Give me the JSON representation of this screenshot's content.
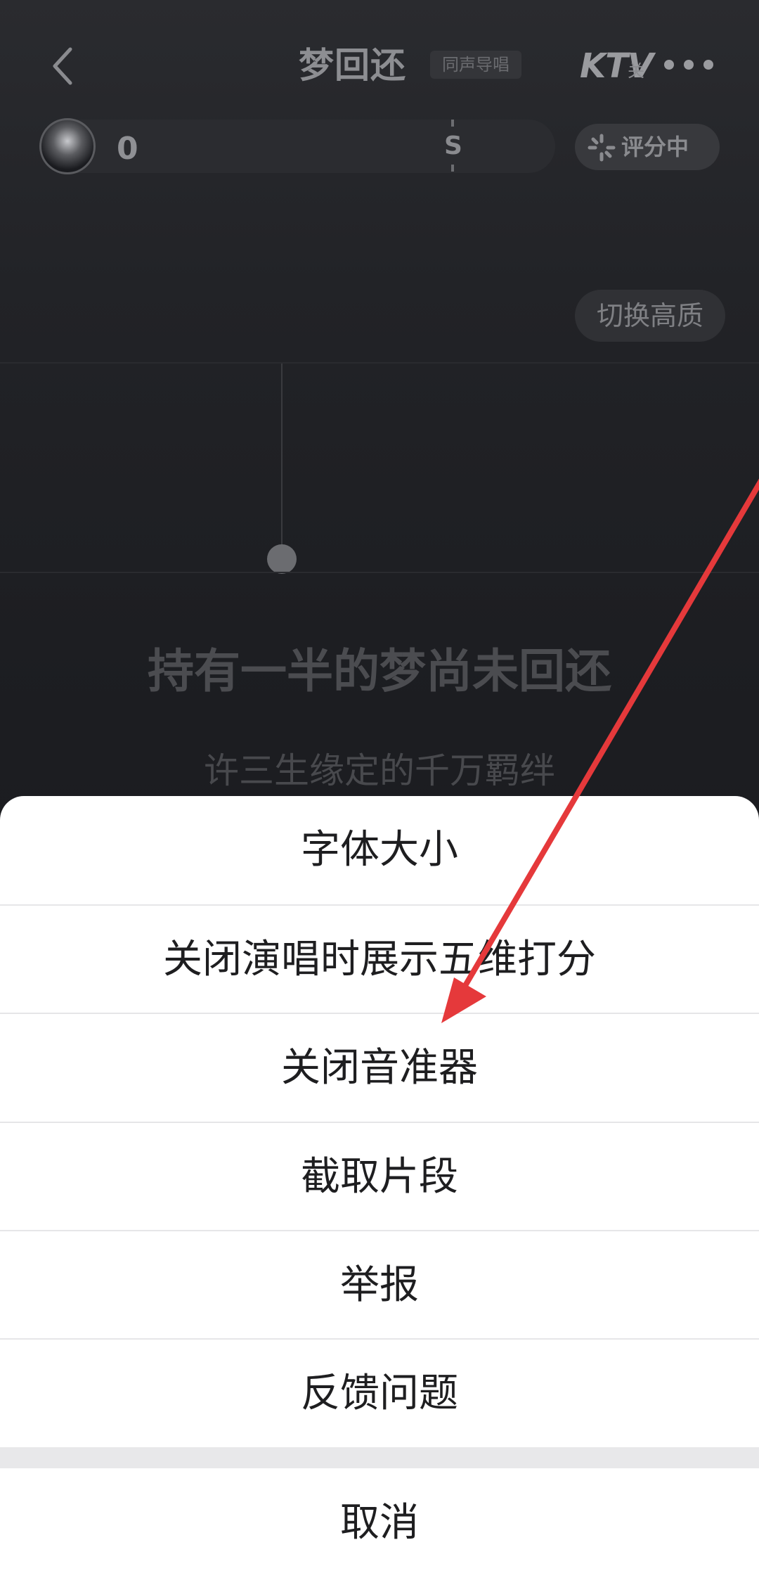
{
  "header": {
    "song_title": "梦回还",
    "guide_badge": "同声导唱",
    "ktv_label": "KTV",
    "ktv_state": "关",
    "back_icon": "back-chevron-icon",
    "more_icon": "more-dots-icon"
  },
  "score": {
    "value": "0",
    "marker_label": "S",
    "scoring_label": "评分中",
    "scoring_icon": "scoring-spinner-icon"
  },
  "quality": {
    "switch_label": "切换高质"
  },
  "lyrics": {
    "current": "持有一半的梦尚未回还",
    "next": "许三生缘定的千万羁绊"
  },
  "sheet": {
    "items": [
      {
        "label": "字体大小"
      },
      {
        "label": "关闭演唱时展示五维打分"
      },
      {
        "label": "关闭音准器"
      },
      {
        "label": "截取片段"
      },
      {
        "label": "举报"
      },
      {
        "label": "反馈问题"
      }
    ],
    "cancel_label": "取消"
  },
  "colors": {
    "background": "#1c1d21",
    "sheet_background": "#ffffff",
    "annotation_arrow": "#e5393b"
  }
}
